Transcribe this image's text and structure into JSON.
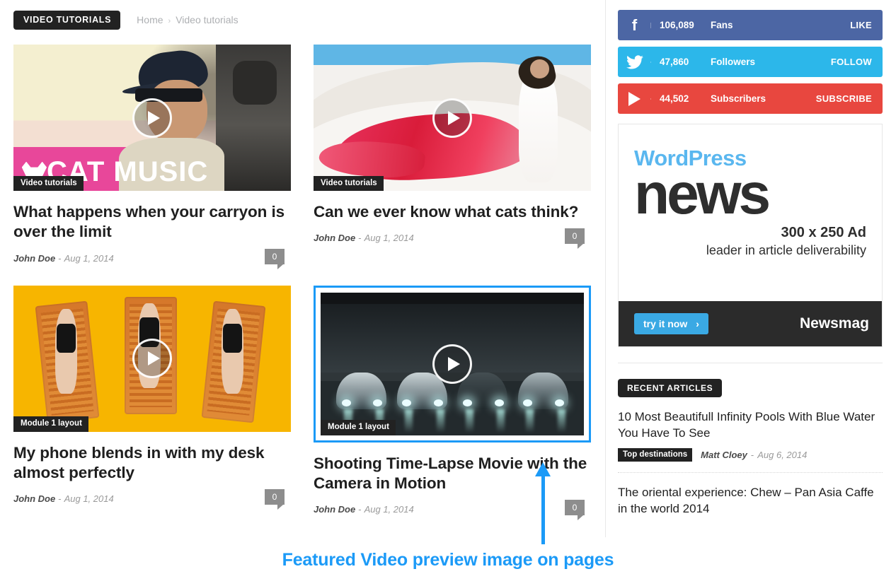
{
  "header": {
    "category_badge": "VIDEO TUTORIALS",
    "breadcrumb": {
      "home": "Home",
      "separator": "›",
      "current": "Video tutorials"
    }
  },
  "posts": [
    {
      "title": "What happens when your carryon is over the limit",
      "author": "John Doe",
      "separator": "-",
      "date": "Aug 1, 2014",
      "comments": "0",
      "flag": "Video tutorials",
      "thumb_text": "CAT MUSIC",
      "play_icon": "play-icon",
      "highlighted": false
    },
    {
      "title": "Can we ever know what cats think?",
      "author": "John Doe",
      "separator": "-",
      "date": "Aug 1, 2014",
      "comments": "0",
      "flag": "Video tutorials",
      "play_icon": "play-icon",
      "highlighted": false
    },
    {
      "title": "My phone blends in with my desk almost perfectly",
      "author": "John Doe",
      "separator": "-",
      "date": "Aug 1, 2014",
      "comments": "0",
      "flag": "Module 1 layout",
      "play_icon": "play-icon",
      "highlighted": false
    },
    {
      "title": "Shooting Time-Lapse Movie with the Camera in Motion",
      "author": "John Doe",
      "separator": "-",
      "date": "Aug 1, 2014",
      "comments": "0",
      "flag": "Module 1 layout",
      "play_icon": "play-icon",
      "highlighted": true
    }
  ],
  "sidebar": {
    "social": [
      {
        "network": "facebook",
        "icon": "facebook-icon",
        "count": "106,089",
        "label": "Fans",
        "action": "LIKE",
        "color": "#4c66a4"
      },
      {
        "network": "twitter",
        "icon": "twitter-icon",
        "count": "47,860",
        "label": "Followers",
        "action": "FOLLOW",
        "color": "#2cb7ea"
      },
      {
        "network": "youtube",
        "icon": "youtube-icon",
        "count": "44,502",
        "label": "Subscribers",
        "action": "SUBSCRIBE",
        "color": "#e8473f"
      }
    ],
    "ad": {
      "brand_top": "WordPress",
      "headline": "news",
      "size_text": "300 x 250 Ad",
      "tagline": "leader in article deliverability",
      "cta": "try it now",
      "cta_arrow": "›",
      "footer_brand": "Newsmag"
    },
    "recent": {
      "heading": "RECENT ARTICLES",
      "items": [
        {
          "title": "10 Most Beautifull Infinity Pools With Blue Water You Have To See",
          "category": "Top destinations",
          "author": "Matt Cloey",
          "separator": "-",
          "date": "Aug 6, 2014"
        },
        {
          "title": "The oriental experience: Chew – Pan Asia Caffe in the world 2014"
        }
      ]
    }
  },
  "annotation": {
    "text": "Featured Video preview image on pages",
    "color": "#1b9af7"
  }
}
